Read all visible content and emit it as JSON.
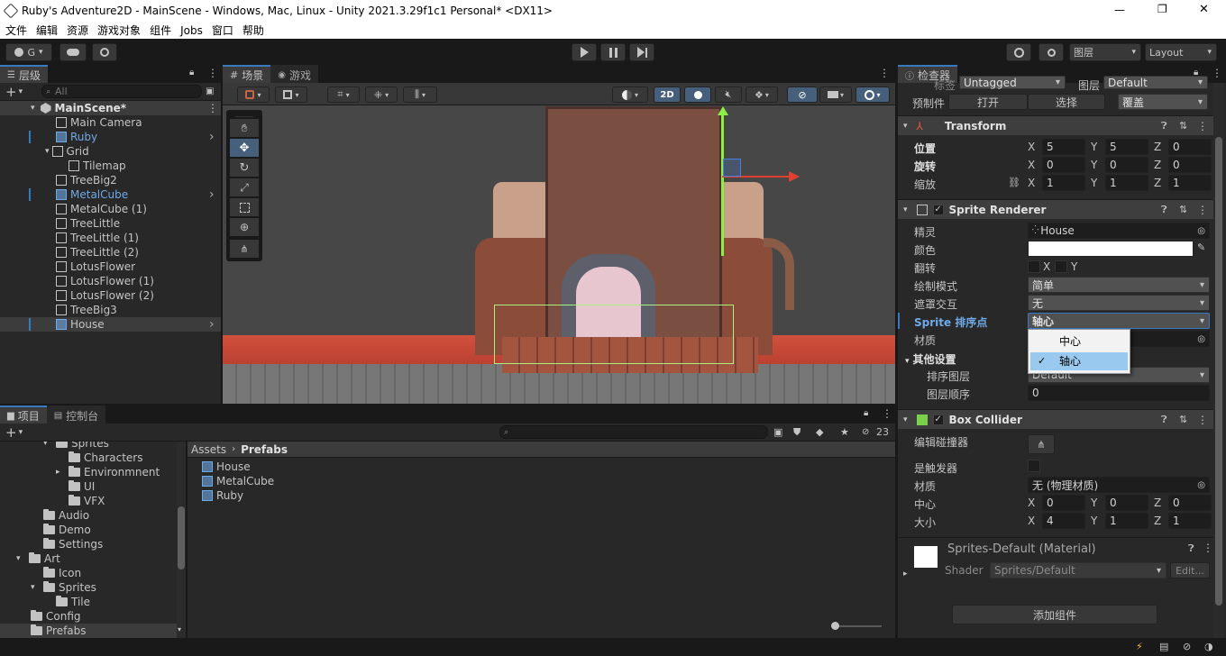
{
  "window": {
    "title": "Ruby's Adventure2D - MainScene - Windows, Mac, Linux - Unity 2021.3.29f1c1 Personal* <DX11>",
    "controls": [
      "—",
      "❐",
      "✕"
    ]
  },
  "menu": [
    "文件",
    "编辑",
    "资源",
    "游戏对象",
    "组件",
    "Jobs",
    "窗口",
    "帮助"
  ],
  "toolbar": {
    "account": "G",
    "layers": "图层",
    "layout": "Layout"
  },
  "hierarchy": {
    "tab": "层级",
    "search_placeholder": "All",
    "scene": "MainScene*",
    "items": [
      {
        "label": "Main Camera",
        "blue": false
      },
      {
        "label": "Ruby",
        "blue": true
      },
      {
        "label": "Grid",
        "blue": false
      },
      {
        "label": "Tilemap",
        "blue": false
      },
      {
        "label": "TreeBig2",
        "blue": false
      },
      {
        "label": "MetalCube",
        "blue": true
      },
      {
        "label": "MetalCube (1)",
        "blue": false
      },
      {
        "label": "TreeLittle",
        "blue": false
      },
      {
        "label": "TreeLittle (1)",
        "blue": false
      },
      {
        "label": "TreeLittle (2)",
        "blue": false
      },
      {
        "label": "LotusFlower",
        "blue": false
      },
      {
        "label": "LotusFlower (1)",
        "blue": false
      },
      {
        "label": "LotusFlower (2)",
        "blue": false
      },
      {
        "label": "TreeBig3",
        "blue": false
      },
      {
        "label": "House",
        "blue": false
      }
    ]
  },
  "scene_view": {
    "tabs": [
      "场景",
      "游戏"
    ],
    "mode_2d": "2D"
  },
  "project": {
    "tabs": [
      "项目",
      "控制台"
    ],
    "tree": [
      "Sprites",
      "Characters",
      "Environmnent",
      "UI",
      "VFX",
      "Audio",
      "Demo",
      "Settings",
      "Art",
      "Icon",
      "Sprites",
      "Tile",
      "Config",
      "Prefabs"
    ],
    "breadcrumb": [
      "Assets",
      "Prefabs"
    ],
    "files": [
      "House",
      "MetalCube",
      "Ruby"
    ],
    "hidden_count": "23"
  },
  "inspector": {
    "tab": "检查器",
    "tag_label": "标签",
    "tag_value": "Untagged",
    "layer_label": "图层",
    "layer_value": "Default",
    "prefab_label": "预制件",
    "prefab_open": "打开",
    "prefab_select": "选择",
    "prefab_override": "覆盖",
    "transform": {
      "title": "Transform",
      "position_label": "位置",
      "rotation_label": "旋转",
      "scale_label": "缩放",
      "position": {
        "x": "5",
        "y": "5",
        "z": "0"
      },
      "rotation": {
        "x": "0",
        "y": "0",
        "z": "0"
      },
      "scale": {
        "x": "1",
        "y": "1",
        "z": "1"
      }
    },
    "sprite_renderer": {
      "title": "Sprite Renderer",
      "sprite_label": "精灵",
      "sprite_value": "House",
      "color_label": "颜色",
      "flip_label": "翻转",
      "flip_x": "X",
      "flip_y": "Y",
      "draw_mode_label": "绘制模式",
      "draw_mode_value": "简单",
      "mask_label": "遮罩交互",
      "mask_value": "无",
      "sort_point_label": "Sprite 排序点",
      "sort_point_value": "轴心",
      "material_label": "材质",
      "other_settings": "其他设置",
      "sorting_layer_label": "排序图层",
      "sorting_layer_value": "Default",
      "order_label": "图层顺序",
      "order_value": "0",
      "dropdown_options": [
        "中心",
        "轴心"
      ],
      "dropdown_selected": "轴心"
    },
    "box_collider": {
      "title": "Box Collider",
      "edit_label": "编辑碰撞器",
      "trigger_label": "是触发器",
      "material_label": "材质",
      "material_value": "无 (物理材质)",
      "center_label": "中心",
      "size_label": "大小",
      "center": {
        "x": "0",
        "y": "0",
        "z": "0"
      },
      "size": {
        "x": "4",
        "y": "1",
        "z": "1"
      }
    },
    "material": {
      "name": "Sprites-Default (Material)",
      "shader_label": "Shader",
      "shader_value": "Sprites/Default",
      "edit_label": "Edit..."
    },
    "add_component": "添加组件"
  },
  "colors": {
    "accent": "#3a79bb",
    "panel": "#282828",
    "prefab_blue": "#6fa9e6",
    "selection": "#2c5d87"
  }
}
